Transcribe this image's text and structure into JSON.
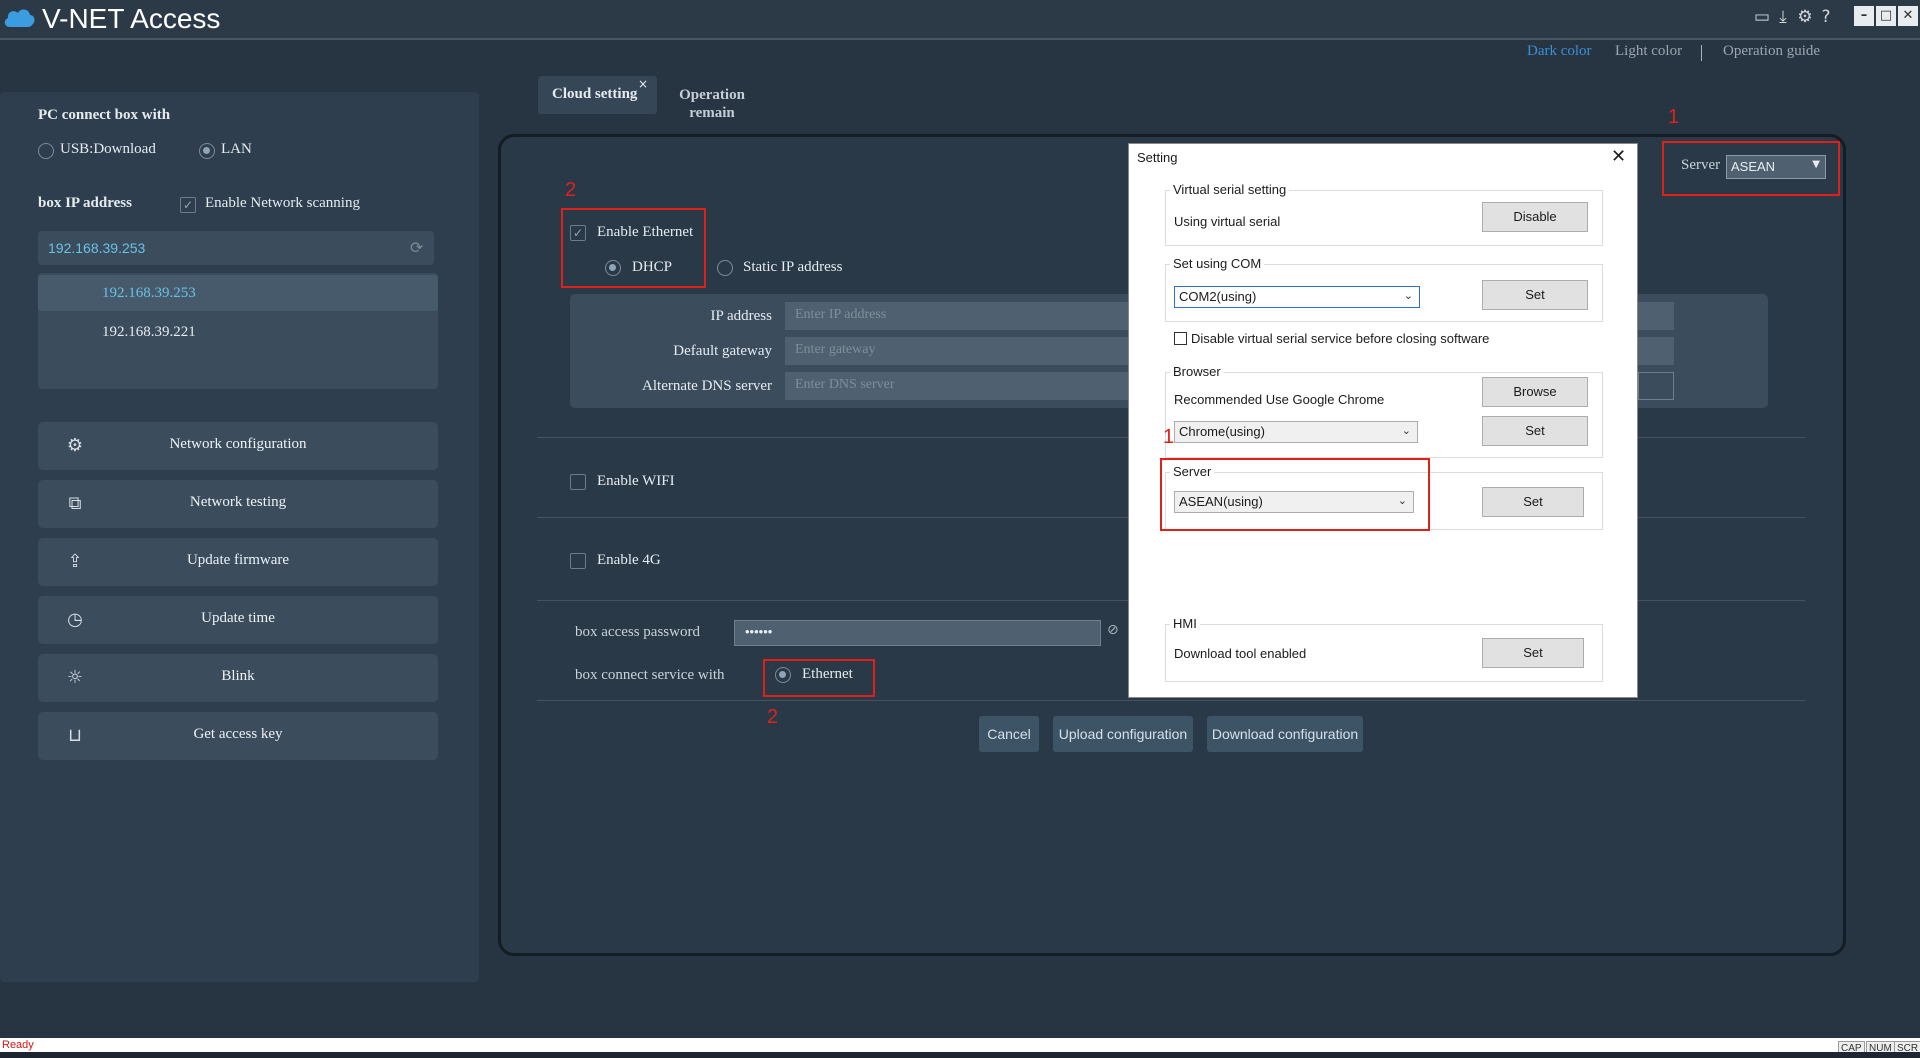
{
  "app": {
    "title": "V-NET Access",
    "toolbar_icons": [
      "monitor-icon",
      "download-icon",
      "gear-icon",
      "help-icon"
    ],
    "window_controls": [
      "minimize-icon",
      "maximize-icon",
      "close-icon"
    ]
  },
  "theme_links": {
    "dark": "Dark color",
    "light": "Light color",
    "guide": "Operation guide"
  },
  "left": {
    "connect_title": "PC connect box with",
    "usb_label": "USB:Download",
    "lan_label": "LAN",
    "box_ip_label": "box IP address",
    "scan_label": "Enable Network scanning",
    "ip_value": "192.168.39.253",
    "ip_list": [
      "192.168.39.253",
      "192.168.39.221"
    ],
    "nav": [
      {
        "label": "Network configuration",
        "icon": "gear-icon"
      },
      {
        "label": "Network testing",
        "icon": "network-icon"
      },
      {
        "label": "Update firmware",
        "icon": "upload-cloud-icon"
      },
      {
        "label": "Update time",
        "icon": "clock-icon"
      },
      {
        "label": "Blink",
        "icon": "sun-icon"
      },
      {
        "label": "Get access key",
        "icon": "inbox-icon"
      }
    ]
  },
  "tabs": {
    "cloud": "Cloud setting",
    "cloud_close": "×",
    "operation_line1": "Operation",
    "operation_line2": "remain"
  },
  "main": {
    "server_label": "Server",
    "server_value": "ASEAN",
    "enable_ethernet": "Enable Ethernet",
    "dhcp": "DHCP",
    "static_ip": "Static IP address",
    "ip_address_label": "IP address",
    "ip_address_placeholder": "Enter IP address",
    "gateway_label": "Default gateway",
    "gateway_placeholder": "Enter gateway",
    "dns_label": "Alternate DNS server",
    "dns_placeholder": "Enter DNS server",
    "enable_wifi": "Enable WIFI",
    "enable_4g": "Enable 4G",
    "password_label": "box access password",
    "password_value": "••••••",
    "connect_service_label": "box connect service with",
    "ethernet": "Ethernet",
    "cancel": "Cancel",
    "upload": "Upload configuration",
    "download": "Download configuration"
  },
  "annotations": {
    "n1": "1",
    "n2": "2"
  },
  "dialog": {
    "title": "Setting",
    "close": "✕",
    "virtual_serial_group": "Virtual serial setting",
    "virtual_serial_text": "Using virtual serial",
    "disable_btn": "Disable",
    "com_group": "Set using COM",
    "com_value": "COM2(using)",
    "set_btn": "Set",
    "disable_service_label": "Disable virtual serial service before closing software",
    "browser_group": "Browser",
    "browser_text": "Recommended Use Google Chrome",
    "browse_btn": "Browse",
    "browser_value": "Chrome(using)",
    "server_group": "Server",
    "server_value": "ASEAN(using)",
    "hmi_group": "HMI",
    "hmi_text": "Download tool enabled"
  },
  "status": {
    "text": "Ready",
    "indicators": [
      "CAP",
      "NUM",
      "SCR"
    ]
  },
  "colors": {
    "accent": "#3b8fd6",
    "annotation": "#e0211a",
    "panel": "#2a3947",
    "background": "#273441"
  }
}
